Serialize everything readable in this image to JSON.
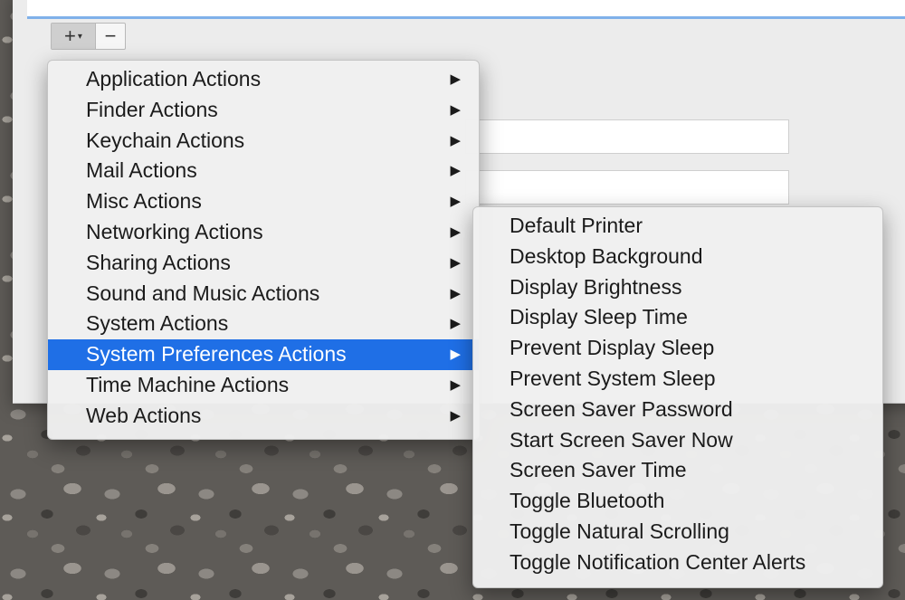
{
  "toolbar": {
    "add_label": "+",
    "add_caret": "▾",
    "remove_label": "−"
  },
  "main_menu": {
    "items": [
      {
        "label": "Application Actions",
        "arrow": "▶"
      },
      {
        "label": "Finder Actions",
        "arrow": "▶"
      },
      {
        "label": "Keychain Actions",
        "arrow": "▶"
      },
      {
        "label": "Mail Actions",
        "arrow": "▶"
      },
      {
        "label": "Misc Actions",
        "arrow": "▶"
      },
      {
        "label": "Networking Actions",
        "arrow": "▶"
      },
      {
        "label": "Sharing Actions",
        "arrow": "▶"
      },
      {
        "label": "Sound and Music Actions",
        "arrow": "▶"
      },
      {
        "label": "System Actions",
        "arrow": "▶"
      },
      {
        "label": "System Preferences Actions",
        "arrow": "▶"
      },
      {
        "label": "Time Machine Actions",
        "arrow": "▶"
      },
      {
        "label": "Web Actions",
        "arrow": "▶"
      }
    ],
    "selected_color": "#1f6fe6"
  },
  "submenu": {
    "items": [
      {
        "label": "Default Printer"
      },
      {
        "label": "Desktop Background"
      },
      {
        "label": "Display Brightness"
      },
      {
        "label": "Display Sleep Time"
      },
      {
        "label": "Prevent Display Sleep"
      },
      {
        "label": "Prevent System Sleep"
      },
      {
        "label": "Screen Saver Password"
      },
      {
        "label": "Start Screen Saver Now"
      },
      {
        "label": "Screen Saver Time"
      },
      {
        "label": "Toggle Bluetooth"
      },
      {
        "label": "Toggle Natural Scrolling"
      },
      {
        "label": "Toggle Notification Center Alerts"
      }
    ]
  }
}
